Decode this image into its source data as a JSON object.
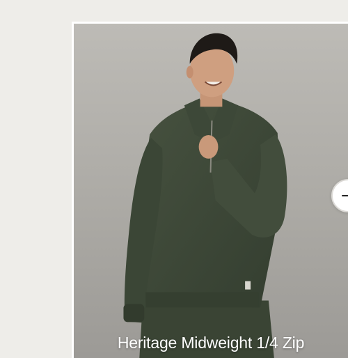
{
  "product_card": {
    "title": "Heritage Midweight 1/4 Zip",
    "image_icon": "product-photo-man-green-quarter-zip",
    "title_color": "#ffffff"
  },
  "carousel": {
    "next_icon": "arrow-right-icon"
  },
  "colors": {
    "page_background": "#eeede9",
    "sweater_green": "#3f4a3a",
    "card_border": "#ffffff"
  }
}
